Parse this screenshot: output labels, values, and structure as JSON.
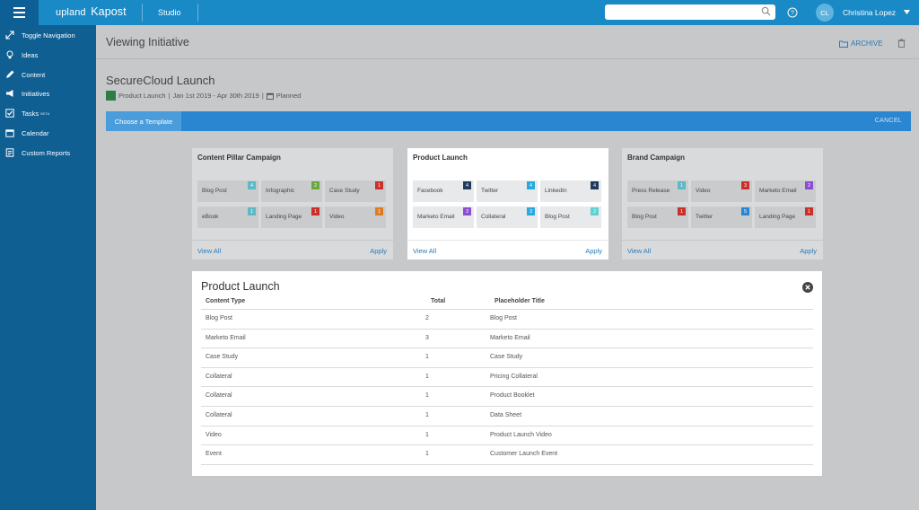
{
  "topbar": {
    "logo_brand": "upland",
    "logo_product": "Kapost",
    "studio": "Studio",
    "search_placeholder": "",
    "user_initials": "CL",
    "user_name": "Christina Lopez"
  },
  "sidebar": {
    "items": [
      {
        "label": "Toggle Navigation",
        "icon": "expand-icon"
      },
      {
        "label": "Ideas",
        "icon": "lightbulb-icon"
      },
      {
        "label": "Content",
        "icon": "pencil-icon"
      },
      {
        "label": "Initiatives",
        "icon": "megaphone-icon"
      },
      {
        "label": "Tasks",
        "icon": "checkbox-icon",
        "badge": "BETA"
      },
      {
        "label": "Calendar",
        "icon": "calendar-icon"
      },
      {
        "label": "Custom Reports",
        "icon": "report-icon"
      }
    ]
  },
  "header": {
    "title": "Viewing Initiative",
    "archive_label": "ARCHIVE"
  },
  "initiative": {
    "name": "SecureCloud Launch",
    "type": "Product Launch",
    "dates": "Jan 1st 2019 - Apr 30th 2019",
    "status": "Planned"
  },
  "template_bar": {
    "choose_label": "Choose a Template",
    "cancel_label": "CANCEL"
  },
  "colors": {
    "topbar": "#1a8ac6",
    "sidebar": "#0f5f93",
    "accent_blue": "#2a86d1",
    "link": "#2a7ab8"
  },
  "templates": [
    {
      "title": "Content Pillar Campaign",
      "selected": false,
      "view_all": "View All",
      "apply": "Apply",
      "tiles": [
        {
          "label": "Blog Post",
          "count": "4",
          "color": "#5fb8c8"
        },
        {
          "label": "Infographic",
          "count": "2",
          "color": "#6aa83b"
        },
        {
          "label": "Case Study",
          "count": "1",
          "color": "#c9302c"
        },
        {
          "label": "eBook",
          "count": "1",
          "color": "#5fb8c8"
        },
        {
          "label": "Landing Page",
          "count": "1",
          "color": "#c9302c"
        },
        {
          "label": "Video",
          "count": "1",
          "color": "#e07b24"
        }
      ]
    },
    {
      "title": "Product Launch",
      "selected": true,
      "view_all": "View All",
      "apply": "Apply",
      "tiles": [
        {
          "label": "Facebook",
          "count": "4",
          "color": "#1f3a5a"
        },
        {
          "label": "Twitter",
          "count": "4",
          "color": "#2aa8e0"
        },
        {
          "label": "LinkedIn",
          "count": "4",
          "color": "#1f3a5a"
        },
        {
          "label": "Marketo Email",
          "count": "3",
          "color": "#8a4fd0"
        },
        {
          "label": "Collateral",
          "count": "3",
          "color": "#2aa8e0"
        },
        {
          "label": "Blog Post",
          "count": "2",
          "color": "#5fd0d0"
        }
      ]
    },
    {
      "title": "Brand Campaign",
      "selected": false,
      "view_all": "View All",
      "apply": "Apply",
      "tiles": [
        {
          "label": "Press Release",
          "count": "1",
          "color": "#5fb8c8"
        },
        {
          "label": "Video",
          "count": "3",
          "color": "#c9302c"
        },
        {
          "label": "Marketo Email",
          "count": "2",
          "color": "#8a4fd0"
        },
        {
          "label": "Blog Post",
          "count": "1",
          "color": "#c9302c"
        },
        {
          "label": "Twitter",
          "count": "5",
          "color": "#2a86d1"
        },
        {
          "label": "Landing Page",
          "count": "1",
          "color": "#c9302c"
        }
      ]
    }
  ],
  "detail": {
    "title": "Product Launch",
    "columns": [
      "Content Type",
      "Total",
      "Placeholder Title"
    ],
    "rows": [
      [
        "Blog Post",
        "2",
        "Blog Post"
      ],
      [
        "Marketo Email",
        "3",
        "Marketo Email"
      ],
      [
        "Case Study",
        "1",
        "Case Study"
      ],
      [
        "Collateral",
        "1",
        "Pricing Collateral"
      ],
      [
        "Collateral",
        "1",
        "Product Booklet"
      ],
      [
        "Collateral",
        "1",
        "Data Sheet"
      ],
      [
        "Video",
        "1",
        "Product Launch Video"
      ],
      [
        "Event",
        "1",
        "Customer Launch Event"
      ]
    ]
  }
}
